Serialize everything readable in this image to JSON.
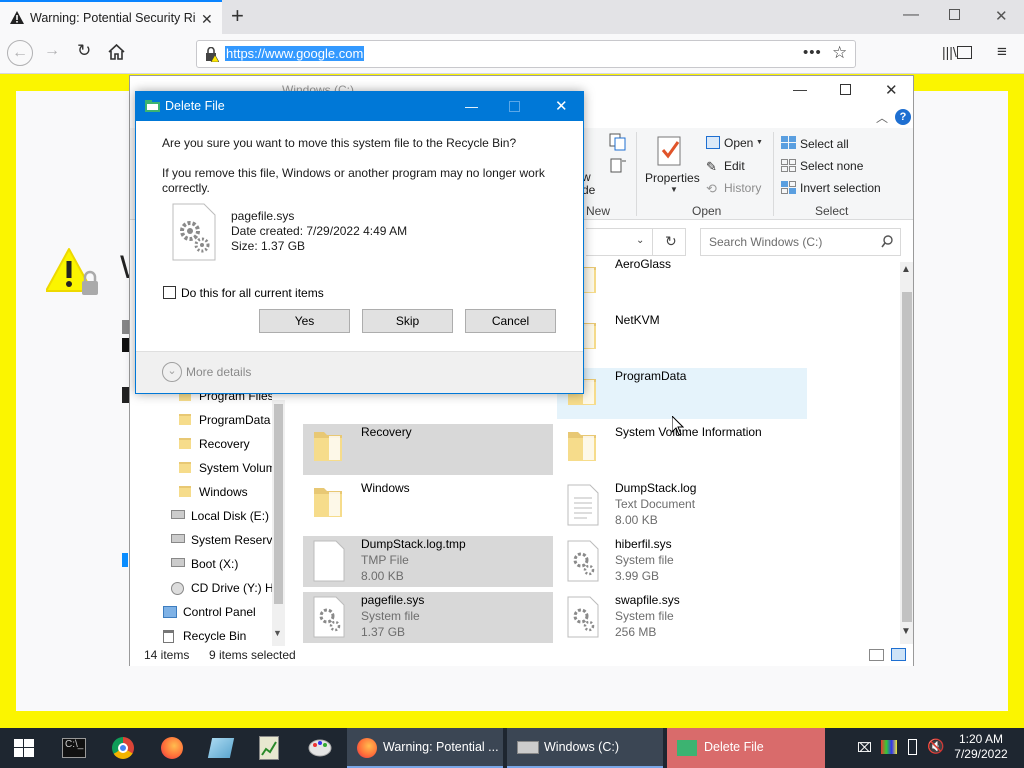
{
  "browser": {
    "tab_title": "Warning: Potential Security Risk Ahead",
    "url": "https://www.google.com"
  },
  "explorer": {
    "window_title": "Windows (C:)",
    "ribbon": {
      "new_partial": "w\nder",
      "new_group": "New",
      "properties": "Properties",
      "open": "Open",
      "edit": "Edit",
      "history": "History",
      "open_group": "Open",
      "select_all": "Select all",
      "select_none": "Select none",
      "invert_selection": "Invert selection",
      "select_group": "Select"
    },
    "search_placeholder": "Search Windows (C:)",
    "nav": [
      {
        "label": "Program Files",
        "type": "folder"
      },
      {
        "label": "ProgramData",
        "type": "folder"
      },
      {
        "label": "Recovery",
        "type": "folder"
      },
      {
        "label": "System Volume Information",
        "type": "folder"
      },
      {
        "label": "Windows",
        "type": "folder"
      },
      {
        "label": "Local Disk (E:)",
        "type": "drive"
      },
      {
        "label": "System Reserved",
        "type": "drive"
      },
      {
        "label": "Boot (X:)",
        "type": "drive"
      },
      {
        "label": "CD Drive (Y:) H",
        "type": "cd"
      },
      {
        "label": "Control Panel",
        "type": "cp"
      },
      {
        "label": "Recycle Bin",
        "type": "bin"
      }
    ],
    "files_left": [
      {
        "name": "Recovery",
        "type": "",
        "size": "",
        "icon": "folder",
        "selected": true
      },
      {
        "name": "Windows",
        "type": "",
        "size": "",
        "icon": "folder",
        "selected": false
      },
      {
        "name": "DumpStack.log.tmp",
        "type": "TMP File",
        "size": "8.00 KB",
        "icon": "file",
        "selected": true
      },
      {
        "name": "pagefile.sys",
        "type": "System file",
        "size": "1.37 GB",
        "icon": "gear-file",
        "selected": true
      }
    ],
    "files_right": [
      {
        "name": "AeroGlass",
        "type": "",
        "size": "",
        "icon": "folder"
      },
      {
        "name": "NetKVM",
        "type": "",
        "size": "",
        "icon": "folder"
      },
      {
        "name": "ProgramData",
        "type": "",
        "size": "",
        "icon": "folder"
      },
      {
        "name": "System Volume Information",
        "type": "",
        "size": "",
        "icon": "folder"
      },
      {
        "name": "DumpStack.log",
        "type": "Text Document",
        "size": "8.00 KB",
        "icon": "text-file"
      },
      {
        "name": "hiberfil.sys",
        "type": "System file",
        "size": "3.99 GB",
        "icon": "gear-file"
      },
      {
        "name": "swapfile.sys",
        "type": "System file",
        "size": "256 MB",
        "icon": "gear-file"
      }
    ],
    "status_items": "14 items",
    "status_selected": "9 items selected"
  },
  "dialog": {
    "title": "Delete File",
    "question": "Are you sure you want to move this system file to the Recycle Bin?",
    "warning": "If you remove this file, Windows or another program may no longer work correctly.",
    "file_name": "pagefile.sys",
    "date_created": "Date created: 7/29/2022 4:49 AM",
    "size": "Size: 1.37 GB",
    "checkbox_label": "Do this for all current items",
    "yes": "Yes",
    "skip": "Skip",
    "cancel": "Cancel",
    "more_details": "More details"
  },
  "taskbar": {
    "firefox_task": "Warning: Potential ...",
    "explorer_task": "Windows (C:)",
    "dialog_task": "Delete File",
    "time": "1:20 AM",
    "date": "7/29/2022"
  },
  "colors": {
    "warning_bg": "#fbf500",
    "accent": "#0078d7",
    "taskbar": "#1e2630",
    "dialog_task": "#d96b6b"
  }
}
